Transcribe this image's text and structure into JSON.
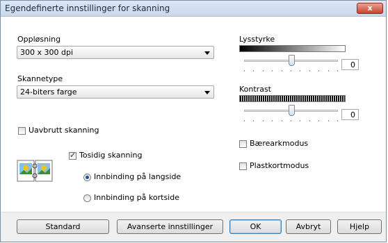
{
  "window": {
    "title": "Egendefinerte innstillinger for skanning",
    "close_label": "x"
  },
  "resolution": {
    "label": "Oppløsning",
    "value": "300 x 300 dpi"
  },
  "scantype": {
    "label": "Skannetype",
    "value": "24-biters farge"
  },
  "brightness": {
    "label": "Lysstyrke",
    "value": "0",
    "level": 0.5
  },
  "contrast": {
    "label": "Kontrast",
    "value": "0",
    "level": 0.5
  },
  "continuous": {
    "label": "Uavbrutt skanning",
    "checked": false
  },
  "onesided": {
    "label": "Tosidig skanning",
    "checked": true
  },
  "binding_long": {
    "label": "Innbinding på langside",
    "checked": true
  },
  "binding_short": {
    "label": "Innbinding på kortside",
    "checked": false
  },
  "carrier": {
    "label": "Bærearkmodus",
    "checked": false
  },
  "plasticcard": {
    "label": "Plastkortmodus",
    "checked": false
  },
  "buttons": {
    "standard": "Standard",
    "advanced": "Avanserte innstillinger",
    "ok": "OK",
    "cancel": "Avbryt",
    "help": "Hjelp"
  }
}
